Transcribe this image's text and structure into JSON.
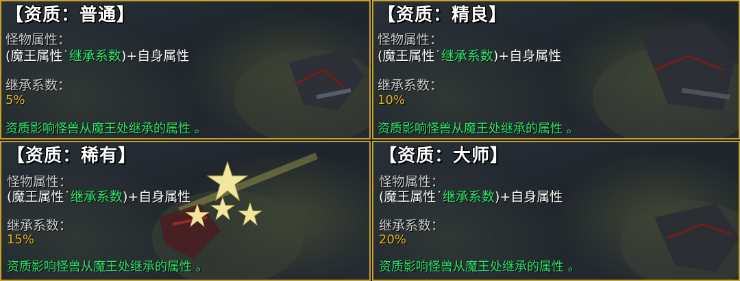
{
  "panels": [
    {
      "title": "【资质：普通】",
      "attr_label": "怪物属性：",
      "formula_open": "(魔王属性",
      "formula_dot": "˙",
      "formula_green": "继承系数",
      "formula_close": ")+自身属性",
      "coef_label": "继承系数：",
      "coef_value": "5%",
      "description": "资质影响怪兽从魔王处继承的属性 。"
    },
    {
      "title": "【资质：精良】",
      "attr_label": "怪物属性：",
      "formula_open": "(魔王属性",
      "formula_dot": "˙",
      "formula_green": "继承系数",
      "formula_close": ")+自身属性",
      "coef_label": "继承系数：",
      "coef_value": "10%",
      "description": "资质影响怪兽从魔王处继承的属性 。"
    },
    {
      "title": "【资质：稀有】",
      "attr_label": "怪物属性：",
      "formula_open": "(魔王属性",
      "formula_dot": "˙",
      "formula_green": "继承系数",
      "formula_close": ")+自身属性",
      "coef_label": "继承系数：",
      "coef_value": "15%",
      "description": "资质影响怪兽从魔王处继承的属性 。"
    },
    {
      "title": "【资质：大师】",
      "attr_label": "怪物属性：",
      "formula_open": "(魔王属性",
      "formula_dot": "˙",
      "formula_green": "继承系数",
      "formula_close": ")+自身属性",
      "coef_label": "继承系数：",
      "coef_value": "20%",
      "description": "资质影响怪兽从魔王处继承的属性 。"
    }
  ],
  "colors": {
    "border": "#c9a227",
    "title": "#ffffff",
    "label": "#cfcfcf",
    "highlight_green": "#2ee56b",
    "value_gold": "#e8b422"
  },
  "icons": [
    "star-icon"
  ]
}
